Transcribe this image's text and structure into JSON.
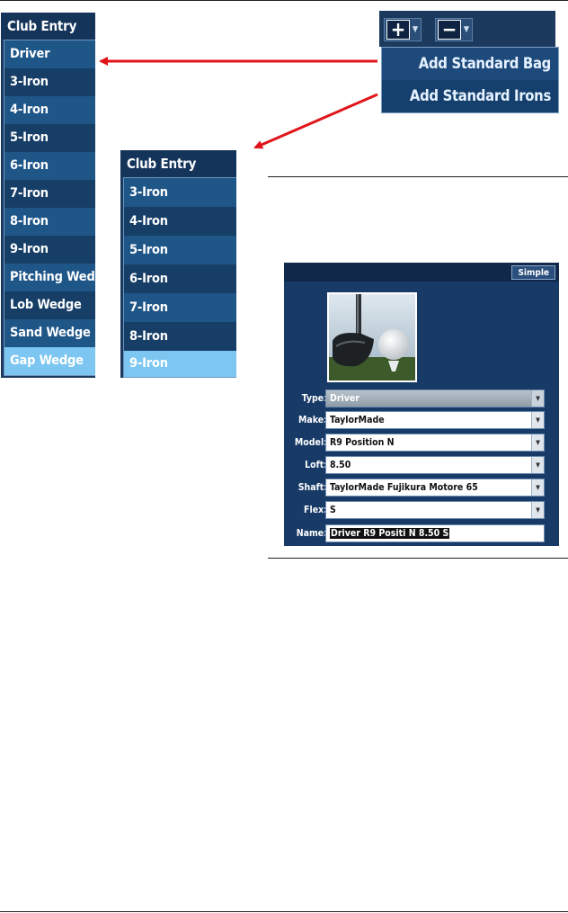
{
  "club_entry_left": {
    "title": "Club Entry",
    "items": [
      {
        "label": "Driver"
      },
      {
        "label": "3-Iron"
      },
      {
        "label": "4-Iron"
      },
      {
        "label": "5-Iron"
      },
      {
        "label": "6-Iron"
      },
      {
        "label": "7-Iron"
      },
      {
        "label": "8-Iron"
      },
      {
        "label": "9-Iron"
      },
      {
        "label": "Pitching Wedge"
      },
      {
        "label": "Lob Wedge"
      },
      {
        "label": "Sand Wedge"
      },
      {
        "label": "Gap Wedge"
      }
    ],
    "selected": "Gap Wedge"
  },
  "club_entry_right": {
    "title": "Club Entry",
    "items": [
      {
        "label": "3-Iron"
      },
      {
        "label": "4-Iron"
      },
      {
        "label": "5-Iron"
      },
      {
        "label": "6-Iron"
      },
      {
        "label": "7-Iron"
      },
      {
        "label": "8-Iron"
      },
      {
        "label": "9-Iron"
      }
    ],
    "selected": "9-Iron"
  },
  "toolbar": {
    "add_icon": "plus-icon",
    "remove_icon": "minus-icon",
    "menu": [
      {
        "label": "Add Standard Bag"
      },
      {
        "label": "Add Standard Irons"
      }
    ]
  },
  "detail": {
    "simple_label": "Simple",
    "fields": {
      "type": {
        "label": "Type:",
        "value": "Driver"
      },
      "make": {
        "label": "Make:",
        "value": "TaylorMade"
      },
      "model": {
        "label": "Model:",
        "value": "R9 Position N"
      },
      "loft": {
        "label": "Loft:",
        "value": "8.50"
      },
      "shaft": {
        "label": "Shaft:",
        "value": "TaylorMade Fujikura Motore 65"
      },
      "flex": {
        "label": "Flex:",
        "value": "S"
      },
      "name": {
        "label": "Name:",
        "value": "Driver R9 Positi N 8.50 S"
      }
    }
  },
  "colors": {
    "panel": "#1a3a60",
    "row_light": "#1f5688",
    "row_dark": "#163e67",
    "selected": "#7cc6f1",
    "arrow": "#e0151b"
  }
}
